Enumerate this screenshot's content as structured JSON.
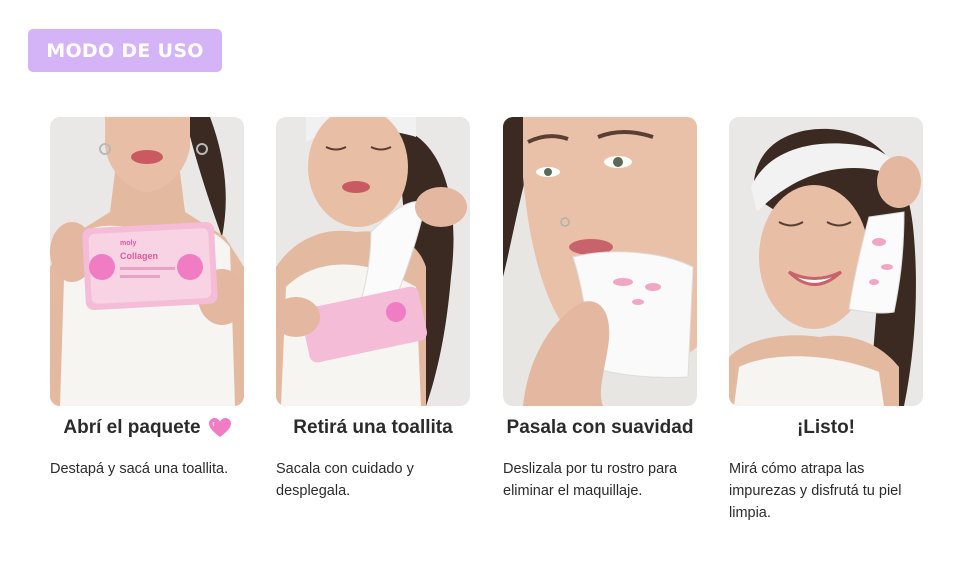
{
  "header": {
    "badge_label": "MODO DE USO"
  },
  "colors": {
    "badge": "#d4b4f7",
    "text": "#2b2b2b",
    "pink_accent": "#f07cc4"
  },
  "steps": [
    {
      "title": "Abrí el paquete",
      "title_icon": "pink-heart-icon",
      "description": "Destapá y sacá una toallita.",
      "image": "woman holding pink wipes package"
    },
    {
      "title": "Retirá una toallita",
      "description": "Sacala con cuidado y desplegala.",
      "image": "woman pulling wipe from package"
    },
    {
      "title": "Pasala con suavidad",
      "description": "Deslizala por tu rostro para eliminar el maquillaje.",
      "image": "woman wiping face"
    },
    {
      "title": "¡Listo!",
      "description": "Mirá cómo atrapa las impurezas y disfrutá tu piel limpia.",
      "image": "smiling woman showing used wipe"
    }
  ],
  "package": {
    "brand": "moly",
    "product": "Collagen"
  }
}
